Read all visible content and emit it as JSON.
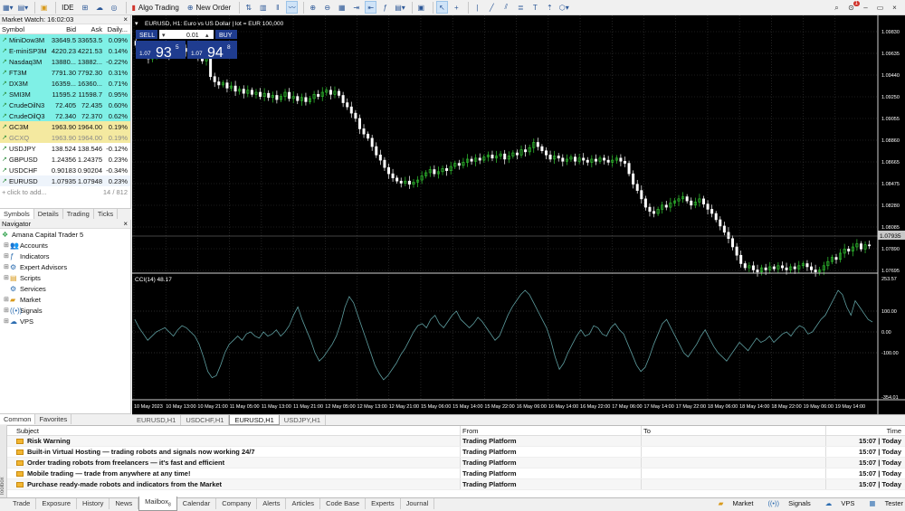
{
  "toolbar": {
    "ide_label": "IDE",
    "algo_label": "Algo Trading",
    "neworder_label": "New Order",
    "badge": "1"
  },
  "market_watch": {
    "title": "Market Watch: 16:02:03",
    "headers": [
      "Symbol",
      "Bid",
      "Ask",
      "Daily..."
    ],
    "rows": [
      {
        "symbol": "MiniDow3M",
        "bid": "33649.5",
        "ask": "33653.5",
        "daily": "0.09%",
        "bg": "#7ff0e6",
        "color": "#111"
      },
      {
        "symbol": "E-miniSP3M",
        "bid": "4220.23",
        "ask": "4221.53",
        "daily": "0.14%",
        "bg": "#7ff0e6",
        "color": "#111"
      },
      {
        "symbol": "Nasdaq3M",
        "bid": "13880...",
        "ask": "13882...",
        "daily": "-0.22%",
        "bg": "#7ff0e6",
        "color": "#111"
      },
      {
        "symbol": "FT3M",
        "bid": "7791.30",
        "ask": "7792.30",
        "daily": "0.31%",
        "bg": "#7ff0e6",
        "color": "#111"
      },
      {
        "symbol": "DX3M",
        "bid": "16359...",
        "ask": "16360...",
        "daily": "0.71%",
        "bg": "#7ff0e6",
        "color": "#111"
      },
      {
        "symbol": "SMI3M",
        "bid": "11595.2",
        "ask": "11598.7",
        "daily": "0.95%",
        "bg": "#7ff0e6",
        "color": "#111"
      },
      {
        "symbol": "CrudeOilN3",
        "bid": "72.405",
        "ask": "72.435",
        "daily": "0.60%",
        "bg": "#7ff0e6",
        "color": "#111"
      },
      {
        "symbol": "CrudeOilQ3",
        "bid": "72.340",
        "ask": "72.370",
        "daily": "0.62%",
        "bg": "#7ff0e6",
        "color": "#111"
      },
      {
        "symbol": "GC3M",
        "bid": "1963.90",
        "ask": "1964.00",
        "daily": "0.19%",
        "bg": "#f4e9a0",
        "color": "#111"
      },
      {
        "symbol": "GCXQ",
        "bid": "1963.90",
        "ask": "1964.00",
        "daily": "0.19%",
        "bg": "#f4e9a0",
        "color": "#888"
      },
      {
        "symbol": "USDJPY",
        "bid": "138.524",
        "ask": "138.546",
        "daily": "-0.12%",
        "bg": "#ffffff",
        "color": "#111"
      },
      {
        "symbol": "GBPUSD",
        "bid": "1.24356",
        "ask": "1.24375",
        "daily": "0.23%",
        "bg": "#ffffff",
        "color": "#111"
      },
      {
        "symbol": "USDCHF",
        "bid": "0.90183",
        "ask": "0.90204",
        "daily": "-0.34%",
        "bg": "#ffffff",
        "color": "#111"
      },
      {
        "symbol": "EURUSD",
        "bid": "1.07935",
        "ask": "1.07948",
        "daily": "0.23%",
        "bg": "#eef4fb",
        "color": "#111"
      }
    ],
    "add_label": "click to add...",
    "count": "14 / 812",
    "tabs": [
      "Symbols",
      "Details",
      "Trading",
      "Ticks"
    ]
  },
  "navigator": {
    "title": "Navigator",
    "root": "Amana Capital Trader 5",
    "items": [
      "Accounts",
      "Indicators",
      "Expert Advisors",
      "Scripts",
      "Services",
      "Market",
      "Signals",
      "VPS"
    ],
    "tabs": [
      "Common",
      "Favorites"
    ]
  },
  "chart": {
    "title": "EURUSD, H1:  Euro vs US Dollar | lot = EUR 100,000",
    "sell_label": "SELL",
    "buy_label": "BUY",
    "lot": "0.01",
    "sell_price_small": "1.07",
    "sell_price_big": "93",
    "sell_price_sup": "5",
    "buy_price_small": "1.07",
    "buy_price_big": "94",
    "buy_price_sup": "8",
    "current_price": "1.07935",
    "price_ticks": [
      "1.09830",
      "1.09635",
      "1.09440",
      "1.09250",
      "1.09055",
      "1.08860",
      "1.08665",
      "1.08475",
      "1.08280",
      "1.08085",
      "1.07890",
      "1.07695"
    ],
    "time_ticks": [
      "10 May 2023",
      "10 May 13:00",
      "10 May 21:00",
      "11 May 05:00",
      "11 May 13:00",
      "11 May 21:00",
      "12 May 05:00",
      "12 May 13:00",
      "12 May 21:00",
      "15 May 06:00",
      "15 May 14:00",
      "15 May 22:00",
      "16 May 06:00",
      "16 May 14:00",
      "16 May 22:00",
      "17 May 06:00",
      "17 May 14:00",
      "17 May 22:00",
      "18 May 06:00",
      "18 May 14:00",
      "18 May 22:00",
      "19 May 06:00",
      "19 May 14:00"
    ],
    "cci_label": "CCI(14) 48.17",
    "cci_ticks": [
      "253.57",
      "100.00",
      "0.00",
      "-100.00",
      "-354.01"
    ],
    "tabs": [
      "EURUSD,H1",
      "USDCHF,H1",
      "EURUSD,H1",
      "USDJPY,H1"
    ],
    "active_tab": 2
  },
  "chart_data": {
    "type": "candlestick",
    "closes": [
      1.0985,
      1.0978,
      1.0975,
      1.0972,
      1.0976,
      1.098,
      1.0983,
      1.098,
      1.0975,
      1.0978,
      1.098,
      1.0982,
      1.0979,
      1.0976,
      1.0978,
      1.0974,
      1.097,
      1.0973,
      1.0955,
      1.095,
      1.0947,
      1.0949,
      1.0944,
      1.0946,
      1.0941,
      1.0943,
      1.0939,
      1.0942,
      1.0938,
      1.094,
      1.0936,
      1.0939,
      1.0935,
      1.0937,
      1.0933,
      1.0936,
      1.094,
      1.0934,
      1.0936,
      1.0932,
      1.0935,
      1.0931,
      1.0934,
      1.0938,
      1.0936,
      1.094,
      1.0942,
      1.0938,
      1.0941,
      1.0937,
      1.093,
      1.0926,
      1.092,
      1.0915,
      1.0905,
      1.09,
      1.0896,
      1.0888,
      1.088,
      1.0875,
      1.0868,
      1.0862,
      1.0858,
      1.0855,
      1.0853,
      1.0855,
      1.0852,
      1.0854,
      1.0856,
      1.086,
      1.0863,
      1.0866,
      1.0862,
      1.0864,
      1.0867,
      1.0865,
      1.0869,
      1.0872,
      1.087,
      1.0873,
      1.0876,
      1.0874,
      1.0877,
      1.0875,
      1.0878,
      1.088,
      1.0877,
      1.0879,
      1.0881,
      1.0876,
      1.0879,
      1.0882,
      1.088,
      1.0885,
      1.0883,
      1.0887,
      1.0892,
      1.0888,
      1.0884,
      1.088,
      1.0876,
      1.0879,
      1.0877,
      1.0874,
      1.0876,
      1.0878,
      1.0874,
      1.0877,
      1.0875,
      1.0873,
      1.0876,
      1.0874,
      1.0877,
      1.0875,
      1.0873,
      1.0875,
      1.0877,
      1.0874,
      1.0872,
      1.0862,
      1.0852,
      1.0846,
      1.0838,
      1.083,
      1.0826,
      1.0824,
      1.0828,
      1.0832,
      1.083,
      1.0834,
      1.0836,
      1.0838,
      1.084,
      1.0836,
      1.0832,
      1.0835,
      1.0838,
      1.0833,
      1.0828,
      1.0824,
      1.0818,
      1.0812,
      1.0806,
      1.08,
      1.0792,
      1.0784,
      1.0776,
      1.0772,
      1.0774,
      1.077,
      1.0768,
      1.0772,
      1.077,
      1.0773,
      1.0771,
      1.0774,
      1.0772,
      1.077,
      1.0773,
      1.0771,
      1.0774,
      1.0776,
      1.0773,
      1.077,
      1.0768,
      1.077,
      1.0774,
      1.0778,
      1.0782,
      1.078,
      1.0786,
      1.079,
      1.0788,
      1.0792,
      1.0795,
      1.079,
      1.0794,
      1.0793
    ],
    "cci": [
      60,
      20,
      -10,
      -40,
      -20,
      0,
      10,
      20,
      0,
      -20,
      10,
      30,
      20,
      0,
      -20,
      -60,
      -120,
      -190,
      -220,
      -210,
      -160,
      -100,
      -60,
      -40,
      -20,
      -40,
      -10,
      0,
      -20,
      -30,
      0,
      -20,
      -10,
      10,
      -20,
      0,
      30,
      80,
      120,
      60,
      10,
      -40,
      -100,
      -140,
      -120,
      -90,
      -60,
      -20,
      40,
      120,
      170,
      140,
      80,
      20,
      -40,
      -100,
      -160,
      -200,
      -230,
      -210,
      -180,
      -150,
      -110,
      -80,
      -40,
      0,
      30,
      40,
      20,
      60,
      80,
      40,
      20,
      50,
      80,
      100,
      60,
      40,
      20,
      40,
      70,
      50,
      20,
      -10,
      -40,
      -20,
      30,
      80,
      120,
      150,
      180,
      200,
      180,
      140,
      100,
      60,
      20,
      -40,
      -120,
      -180,
      -150,
      -100,
      -60,
      -20,
      10,
      -20,
      -10,
      30,
      20,
      -10,
      -20,
      20,
      40,
      10,
      -10,
      -60,
      -110,
      -160,
      -190,
      -170,
      -120,
      -60,
      -10,
      40,
      60,
      20,
      -20,
      -60,
      -100,
      -120,
      -90,
      -60,
      -20,
      10,
      -30,
      -70,
      -100,
      -120,
      -140,
      -110,
      -80,
      -50,
      -70,
      -90,
      -60,
      -30,
      -50,
      -40,
      -20,
      -50,
      -30,
      -10,
      0,
      -20,
      10,
      30,
      20,
      -10,
      0,
      30,
      60,
      80,
      120,
      160,
      200,
      180,
      120,
      80,
      150,
      120,
      90,
      60,
      48
    ]
  },
  "toolbox": {
    "headers": [
      "Subject",
      "From",
      "To",
      "Time"
    ],
    "rows": [
      {
        "subject": "Risk Warning",
        "from": "Trading Platform",
        "to": "",
        "time": "15:07 | Today"
      },
      {
        "subject": "Built-in Virtual Hosting — trading robots and signals now working 24/7",
        "from": "Trading Platform",
        "to": "",
        "time": "15:07 | Today"
      },
      {
        "subject": "Order trading robots from freelancers — it's fast and efficient",
        "from": "Trading Platform",
        "to": "",
        "time": "15:07 | Today"
      },
      {
        "subject": "Mobile trading — trade from anywhere at any time!",
        "from": "Trading Platform",
        "to": "",
        "time": "15:07 | Today"
      },
      {
        "subject": "Purchase ready-made robots and indicators from the Market",
        "from": "Trading Platform",
        "to": "",
        "time": "15:07 | Today"
      }
    ],
    "vertical_label": "Toolbox",
    "tabs": [
      "Trade",
      "Exposure",
      "History",
      "News",
      "Mailbox",
      "Calendar",
      "Company",
      "Alerts",
      "Articles",
      "Code Base",
      "Experts",
      "Journal"
    ],
    "active_tab": 4,
    "mailbox_count": "8"
  },
  "statusbar": {
    "market": "Market",
    "signals": "Signals",
    "vps": "VPS",
    "tester": "Tester"
  },
  "colors": {
    "bull": "#33cc33",
    "bear": "#ffffff",
    "cci": "#5e9ea0",
    "trade_panel": "#1f3c8f"
  }
}
